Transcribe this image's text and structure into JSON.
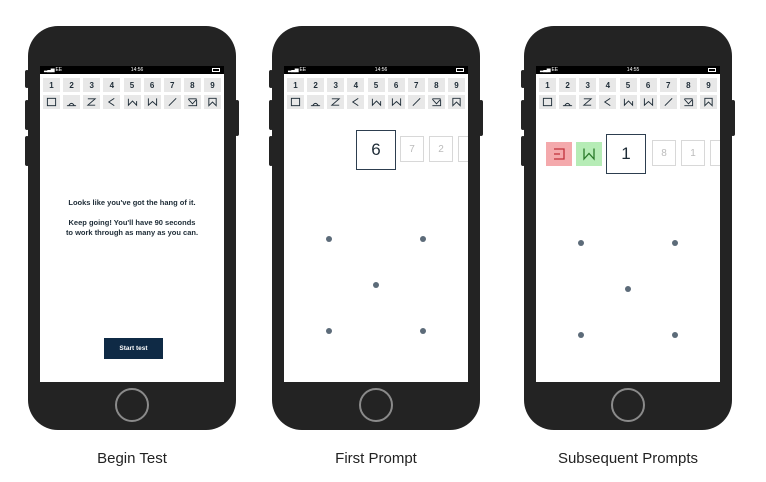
{
  "status_bar": {
    "p1": {
      "carrier": "EE",
      "time": "14:56"
    },
    "p2": {
      "carrier": "EE",
      "time": "14:56"
    },
    "p3": {
      "carrier": "EE",
      "time": "14:55"
    }
  },
  "digits": [
    "1",
    "2",
    "3",
    "4",
    "5",
    "6",
    "7",
    "8",
    "9"
  ],
  "symbol_icons": [
    "square-icon",
    "triangle-arc-icon",
    "z-icon",
    "chevron-left-icon",
    "broken-w-icon",
    "w-icon",
    "slash-icon",
    "corner-arrow-icon",
    "bookmark-icon"
  ],
  "begin": {
    "line1": "Looks like you've got the hang of it.",
    "line2": "Keep going! You'll have 90 seconds",
    "line3": "to work through as many as you can.",
    "button": "Start test"
  },
  "first": {
    "current": "6",
    "next": [
      "7",
      "2"
    ]
  },
  "subsequent": {
    "current": "1",
    "next": [
      "8",
      "1"
    ],
    "wrong_icon": "bracket-icon",
    "correct_icon": "w-icon"
  },
  "captions": [
    "Begin Test",
    "First Prompt",
    "Subsequent Prompts"
  ],
  "colors": {
    "accent": "#0f2a45",
    "wrong": "#f4a9ac",
    "correct": "#b6ecb6"
  }
}
